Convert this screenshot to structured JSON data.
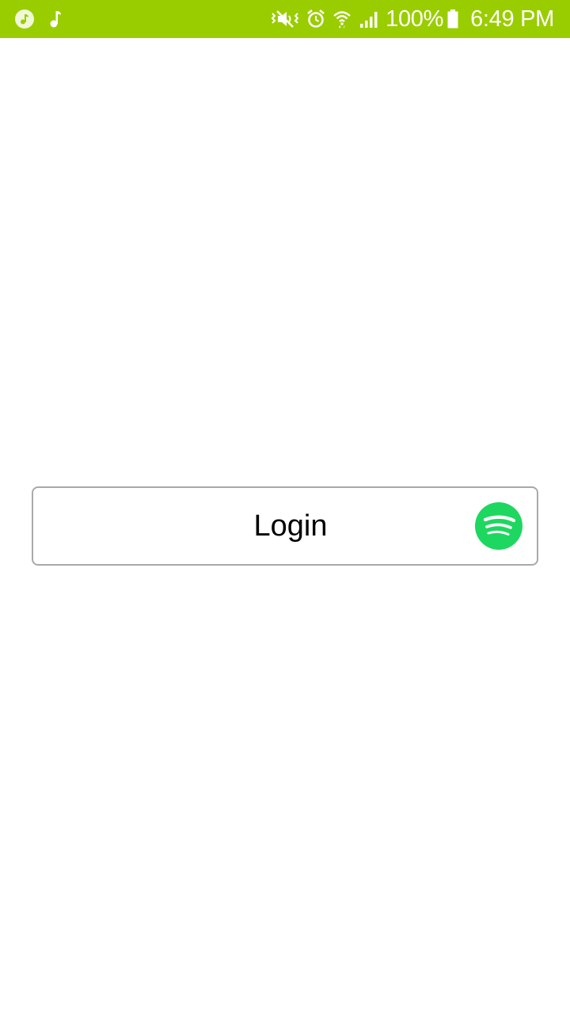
{
  "status_bar": {
    "background": "#9acd00",
    "left_icons": [
      "music-app-icon",
      "music-note-icon"
    ],
    "right_icons": [
      "vibrate-icon",
      "alarm-icon",
      "wifi-icon",
      "signal-icon",
      "battery-icon"
    ],
    "battery_text": "100%",
    "time": "6:49 PM"
  },
  "main": {
    "login_button": {
      "label": "Login",
      "icon": "spotify-logo-icon",
      "icon_color": "#1ed760",
      "border_color": "#a9a9a9"
    }
  }
}
